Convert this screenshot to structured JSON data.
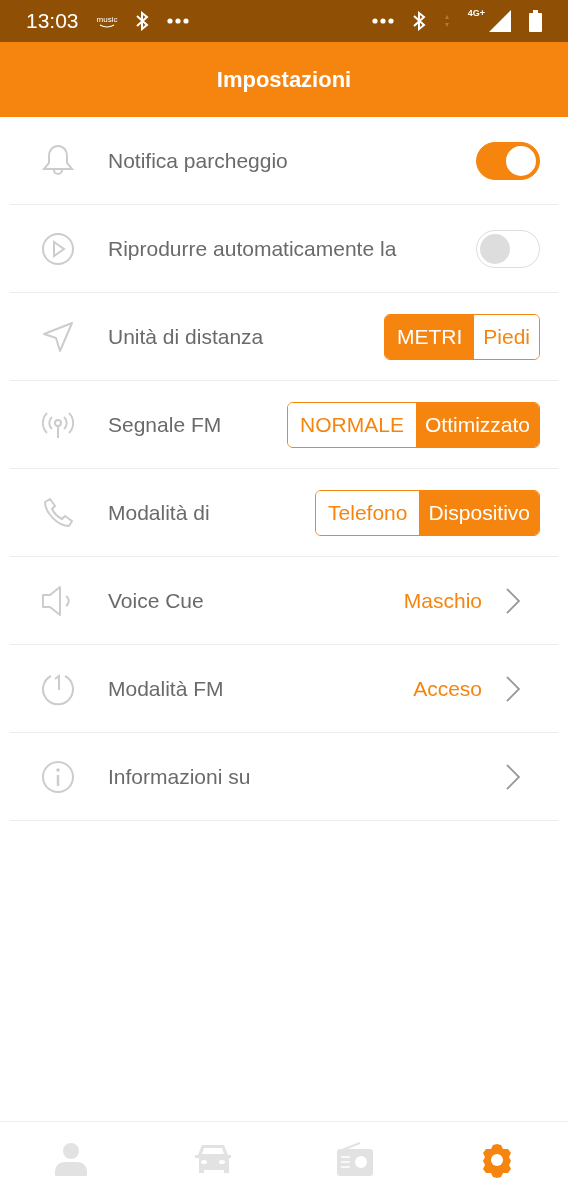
{
  "status_bar": {
    "time": "13:03",
    "music_logo": "music",
    "network": "4G+"
  },
  "header": {
    "title": "Impostazioni"
  },
  "settings": [
    {
      "kind": "toggle",
      "label": "Notifica parcheggio",
      "on": true
    },
    {
      "kind": "toggle",
      "label": "Riprodurre automaticamente la",
      "on": false
    },
    {
      "kind": "segmented",
      "label": "Unità di distanza",
      "options": [
        {
          "label": "METRI",
          "selected": true
        },
        {
          "label": "Piedi",
          "selected": false
        }
      ]
    },
    {
      "kind": "segmented",
      "label": "Segnale FM",
      "options": [
        {
          "label": "NORMALE",
          "selected": false
        },
        {
          "label": "Ottimizzato",
          "selected": true
        }
      ]
    },
    {
      "kind": "segmented",
      "label": "Modalità di",
      "options": [
        {
          "label": "Telefono",
          "selected": false
        },
        {
          "label": "Dispositivo",
          "selected": true
        }
      ]
    },
    {
      "kind": "link",
      "label": "Voice Cue",
      "value": "Maschio"
    },
    {
      "kind": "link",
      "label": "Modalità FM",
      "value": "Acceso"
    },
    {
      "kind": "link",
      "label": "Informazioni su"
    }
  ],
  "tab_bar": [
    {
      "selected": false
    },
    {
      "selected": false
    },
    {
      "selected": false
    },
    {
      "selected": true
    }
  ]
}
